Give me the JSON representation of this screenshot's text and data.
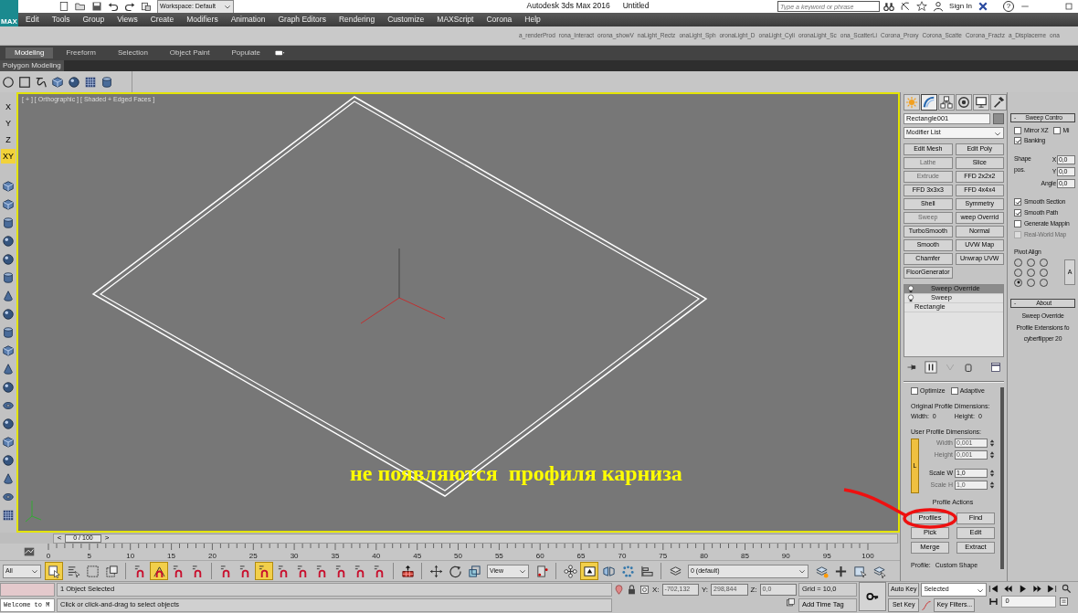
{
  "title_bar": {
    "logo_text": "MAX",
    "workspace": "Workspace: Default",
    "app_title": "Autodesk 3ds Max 2016",
    "document_title": "Untitled",
    "search": {
      "placeholder": "Type a keyword or phrase"
    },
    "sign_in": "Sign In",
    "help": "?"
  },
  "menu": [
    "Edit",
    "Tools",
    "Group",
    "Views",
    "Create",
    "Modifiers",
    "Animation",
    "Graph Editors",
    "Rendering",
    "Customize",
    "MAXScript",
    "Corona",
    "Help"
  ],
  "script_toolbar": [
    "a_renderProd",
    "rona_Interact",
    "orona_showV",
    "naLight_Rectz",
    "onaLight_Sph",
    "oronaLight_D",
    "onaLight_Cyli",
    "oronaLight_Sc",
    "ona_ScatterLi",
    "Corona_Proxy",
    "Corona_Scatte",
    "Corona_Fractz",
    "a_Displaceme",
    "ona"
  ],
  "ribbon": {
    "tabs": [
      {
        "label": "Modeling",
        "selected": true
      },
      {
        "label": "Freeform",
        "selected": false
      },
      {
        "label": "Selection",
        "selected": false
      },
      {
        "label": "Object Paint",
        "selected": false
      },
      {
        "label": "Populate",
        "selected": false
      }
    ],
    "panel": "Polygon Modeling"
  },
  "axis_constraints": [
    {
      "label": "X",
      "selected": false
    },
    {
      "label": "Y",
      "selected": false
    },
    {
      "label": "Z",
      "selected": false
    },
    {
      "label": "XY",
      "selected": true
    }
  ],
  "viewport": {
    "label": "[ + ] [ Orthographic ] [ Shaded + Edged Faces ]",
    "active": true
  },
  "annotation": {
    "text": "не появляются  профиля карниза"
  },
  "time_slider": {
    "prev": "<",
    "position": "0 / 100",
    "next": ">",
    "level": 0
  },
  "timeline_ticks": [
    "0",
    "5",
    "10",
    "15",
    "20",
    "25",
    "30",
    "35",
    "40",
    "45",
    "50",
    "55",
    "60",
    "65",
    "70",
    "75",
    "80",
    "85",
    "90",
    "95",
    "100"
  ],
  "main_toolbar": [
    {
      "kind": "filter-dropdown",
      "value": "All"
    },
    {
      "kind": "select",
      "selected": true
    },
    {
      "kind": "select-name",
      "selected": false
    },
    {
      "kind": "region",
      "selected": false
    },
    {
      "kind": "crossing",
      "selected": false
    },
    {
      "kind": "separator"
    },
    {
      "kind": "snap",
      "selected": false
    },
    {
      "kind": "angle-snap",
      "selected": true
    },
    {
      "kind": "snap",
      "selected": false
    },
    {
      "kind": "snap",
      "selected": false
    },
    {
      "kind": "separator"
    },
    {
      "kind": "snap",
      "selected": false
    },
    {
      "kind": "snap",
      "selected": false
    },
    {
      "kind": "snap",
      "selected": true
    },
    {
      "kind": "snap",
      "selected": false
    },
    {
      "kind": "snap",
      "selected": false
    },
    {
      "kind": "snap",
      "selected": false
    },
    {
      "kind": "snap",
      "selected": false
    },
    {
      "kind": "snap",
      "selected": false
    },
    {
      "kind": "snap",
      "selected": false
    },
    {
      "kind": "separator"
    },
    {
      "kind": "build",
      "selected": false
    },
    {
      "kind": "separator"
    },
    {
      "kind": "move",
      "selected": false
    },
    {
      "kind": "rotate",
      "selected": false
    },
    {
      "kind": "scale",
      "selected": false
    },
    {
      "kind": "view-dropdown",
      "value": "View"
    },
    {
      "kind": "pivot",
      "selected": false
    },
    {
      "kind": "separator"
    },
    {
      "kind": "manipulate",
      "selected": false
    },
    {
      "kind": "keyboard",
      "selected": true
    },
    {
      "kind": "mirror",
      "selected": false
    },
    {
      "kind": "array",
      "selected": false
    },
    {
      "kind": "align",
      "selected": false
    },
    {
      "kind": "separator"
    },
    {
      "kind": "layers",
      "selected": false
    },
    {
      "kind": "layer-dropdown",
      "value": "0 (default)"
    },
    {
      "kind": "layer-new",
      "selected": false
    },
    {
      "kind": "plus",
      "selected": false
    },
    {
      "kind": "layer-select",
      "selected": false
    },
    {
      "kind": "layer-pick",
      "selected": false
    }
  ],
  "command_panel": {
    "tabs": [
      {
        "kind": "create",
        "selected": false
      },
      {
        "kind": "modify",
        "selected": true
      },
      {
        "kind": "hierarchy",
        "selected": false
      },
      {
        "kind": "motion",
        "selected": false
      },
      {
        "kind": "display",
        "selected": false
      },
      {
        "kind": "utilities",
        "selected": false
      }
    ],
    "object_name": "Rectangle001",
    "modifier_list": "Modifier List",
    "modifier_buttons": [
      {
        "label": "Edit Mesh",
        "disabled": false
      },
      {
        "label": "Edit Poly",
        "disabled": false
      },
      {
        "label": "Lathe",
        "disabled": true
      },
      {
        "label": "Slice",
        "disabled": false
      },
      {
        "label": "Extrude",
        "disabled": true
      },
      {
        "label": "FFD 2x2x2",
        "disabled": false
      },
      {
        "label": "FFD 3x3x3",
        "disabled": false
      },
      {
        "label": "FFD 4x4x4",
        "disabled": false
      },
      {
        "label": "Shell",
        "disabled": false
      },
      {
        "label": "Symmetry",
        "disabled": false
      },
      {
        "label": "Sweep",
        "disabled": true
      },
      {
        "label": "weep Overrid",
        "disabled": false
      },
      {
        "label": "TurboSmooth",
        "disabled": false
      },
      {
        "label": "Normal",
        "disabled": false
      },
      {
        "label": "Smooth",
        "disabled": false
      },
      {
        "label": "UVW Map",
        "disabled": false
      },
      {
        "label": "Chamfer",
        "disabled": false
      },
      {
        "label": "Unwrap UVW",
        "disabled": false
      },
      {
        "label": "FloorGenerator",
        "disabled": false
      }
    ],
    "stack": [
      {
        "label": "Sweep Override",
        "selected": true,
        "kind": "modifier"
      },
      {
        "label": "Sweep",
        "selected": false,
        "kind": "modifier"
      },
      {
        "label": "Rectangle",
        "selected": false,
        "kind": "base"
      }
    ],
    "profile_options": [
      {
        "label": "Optimize",
        "checked": false
      },
      {
        "label": "Adaptive",
        "checked": false
      }
    ],
    "original_heading": "Original Profile Dimensions:",
    "original": [
      {
        "label": "Width:",
        "value": "0"
      },
      {
        "label": "Height:",
        "value": "0"
      }
    ],
    "user_heading": "User Profile Dimensions:",
    "lock": {
      "label": "L",
      "on": true
    },
    "spinners": [
      {
        "label": "Width",
        "value": "0,001",
        "disabled": true
      },
      {
        "label": "Height",
        "value": "0,001",
        "disabled": true
      },
      {
        "label": "Scale W",
        "value": "1,0",
        "disabled": false
      },
      {
        "label": "Scale H",
        "value": "1,0",
        "disabled": true
      }
    ],
    "actions_heading": "Profile Actions",
    "actions": [
      {
        "label": "Profiles",
        "circled": true
      },
      {
        "label": "Find",
        "circled": false
      },
      {
        "label": "Pick",
        "circled": false
      },
      {
        "label": "Edit",
        "circled": false
      },
      {
        "label": "Merge",
        "circled": false
      },
      {
        "label": "Extract",
        "circled": false
      }
    ],
    "profile": {
      "label": "Profile:",
      "value": "Custom Shape"
    }
  },
  "sweep_controls": {
    "title": "Sweep Contro",
    "collapse": "-",
    "mirror": [
      {
        "label": "Mirror XZ",
        "checked": false
      },
      {
        "label": "Mi",
        "checked": false
      }
    ],
    "banking": {
      "label": "Banking",
      "checked": true
    },
    "shape_label": "Shape",
    "pos_label": "pos.",
    "fields": [
      {
        "label": "X",
        "value": "0,0"
      },
      {
        "label": "Y",
        "value": "0,0"
      },
      {
        "label": "Angle",
        "value": "0,0"
      }
    ],
    "options": [
      {
        "label": "Smooth Section",
        "checked": true,
        "disabled": false
      },
      {
        "label": "Smooth Path",
        "checked": true,
        "disabled": false
      },
      {
        "label": "Generate Mappin",
        "checked": false,
        "disabled": false
      },
      {
        "label": "Real-World Map",
        "checked": false,
        "disabled": true
      }
    ],
    "pivot_label": "Pivot Align",
    "pivot": [
      {
        "selected": false
      },
      {
        "selected": false
      },
      {
        "selected": false
      },
      {
        "selected": false
      },
      {
        "selected": false
      },
      {
        "selected": false
      },
      {
        "selected": true
      },
      {
        "selected": false
      },
      {
        "selected": false
      }
    ],
    "pivot_button": "A"
  },
  "about": {
    "title": "About",
    "collapse": "-",
    "lines": [
      "Sweep Override",
      "Profile Extensions fo",
      "cyberflipper 20"
    ]
  },
  "status_bar": {
    "listener": "Welcome to M",
    "selection": "1 Object Selected",
    "prompt": "Click or click-and-drag to select objects",
    "coords": [
      {
        "label": "X:",
        "value": "-702,132"
      },
      {
        "label": "Y:",
        "value": "298,844"
      },
      {
        "label": "Z:",
        "value": "0,0"
      }
    ],
    "grid": "Grid = 10,0",
    "time_tag": "Add Time Tag"
  },
  "animation": {
    "auto_key": "Auto Key",
    "set_key": "Set Key",
    "key_mode": "Selected",
    "key_filters": "Key Filters...",
    "frame": "0"
  }
}
